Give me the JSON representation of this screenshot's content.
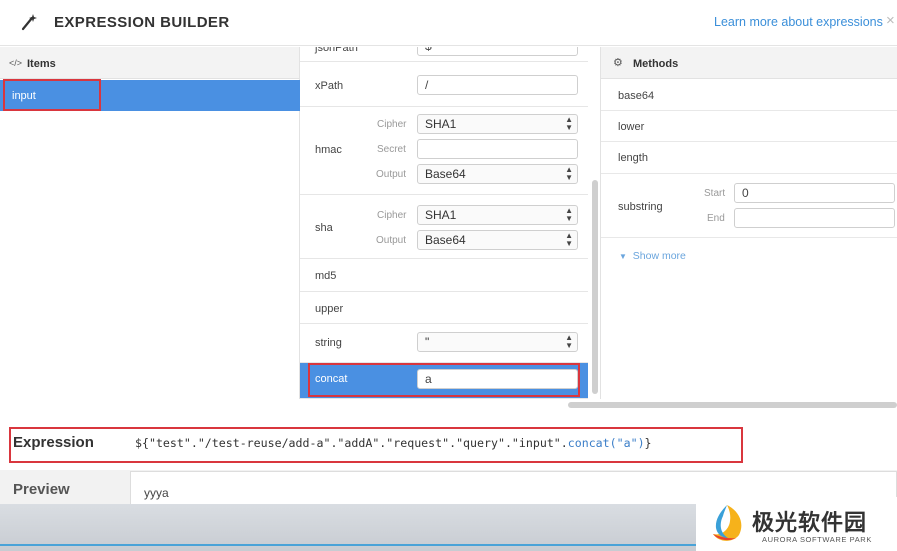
{
  "header": {
    "title": "EXPRESSION BUILDER",
    "learn_more": "Learn more about expressions",
    "close": "×"
  },
  "items_panel": {
    "icon": "</>",
    "title": "Items",
    "items": [
      {
        "label": "input",
        "selected": true
      }
    ]
  },
  "functions": {
    "jsonpath": {
      "name": "jsonPath",
      "value": "$"
    },
    "xpath": {
      "name": "xPath",
      "value": "/"
    },
    "hmac": {
      "name": "hmac",
      "cipher_label": "Cipher",
      "cipher": "SHA1",
      "secret_label": "Secret",
      "secret": "",
      "output_label": "Output",
      "output": "Base64"
    },
    "sha": {
      "name": "sha",
      "cipher_label": "Cipher",
      "cipher": "SHA1",
      "output_label": "Output",
      "output": "Base64"
    },
    "md5": {
      "name": "md5"
    },
    "upper": {
      "name": "upper"
    },
    "string": {
      "name": "string",
      "value": "\""
    },
    "concat": {
      "name": "concat",
      "value": "a",
      "selected": true
    }
  },
  "methods_panel": {
    "icon": "gears-icon",
    "title": "Methods",
    "base64": "base64",
    "lower": "lower",
    "length": "length",
    "substring": {
      "name": "substring",
      "start_label": "Start",
      "start": "0",
      "end_label": "End",
      "end": ""
    },
    "show_more": "Show more"
  },
  "expression": {
    "label": "Expression",
    "prefix": "${\"test\".\"/test-reuse/add-a\".\"addA\".\"request\".\"query\".\"input\".",
    "fn": "concat(\"a\")",
    "suffix": "}"
  },
  "preview": {
    "label": "Preview",
    "value": "yyya"
  },
  "watermark": {
    "cn": "极光软件园",
    "en": "AURORA SOFTWARE PARK"
  },
  "colors": {
    "accent": "#4a90e2",
    "highlight": "#d9363e",
    "link": "#3b8fd9"
  }
}
